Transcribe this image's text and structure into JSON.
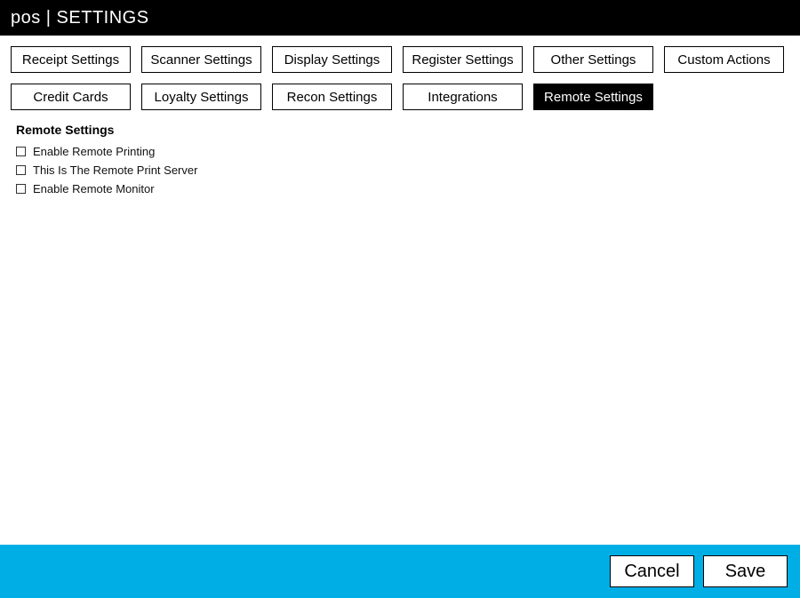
{
  "titlebar": {
    "text": "pos | SETTINGS"
  },
  "tabs": [
    {
      "label": "Receipt Settings",
      "active": false
    },
    {
      "label": "Scanner Settings",
      "active": false
    },
    {
      "label": "Display Settings",
      "active": false
    },
    {
      "label": "Register Settings",
      "active": false
    },
    {
      "label": "Other Settings",
      "active": false
    },
    {
      "label": "Custom Actions",
      "active": false
    },
    {
      "label": "Credit Cards",
      "active": false
    },
    {
      "label": "Loyalty Settings",
      "active": false
    },
    {
      "label": "Recon Settings",
      "active": false
    },
    {
      "label": "Integrations",
      "active": false
    },
    {
      "label": "Remote Settings",
      "active": true
    }
  ],
  "section": {
    "title": "Remote Settings",
    "options": [
      {
        "label": "Enable Remote Printing",
        "checked": false
      },
      {
        "label": "This Is The Remote Print Server",
        "checked": false
      },
      {
        "label": "Enable Remote Monitor",
        "checked": false
      }
    ]
  },
  "footer": {
    "cancel": "Cancel",
    "save": "Save"
  }
}
